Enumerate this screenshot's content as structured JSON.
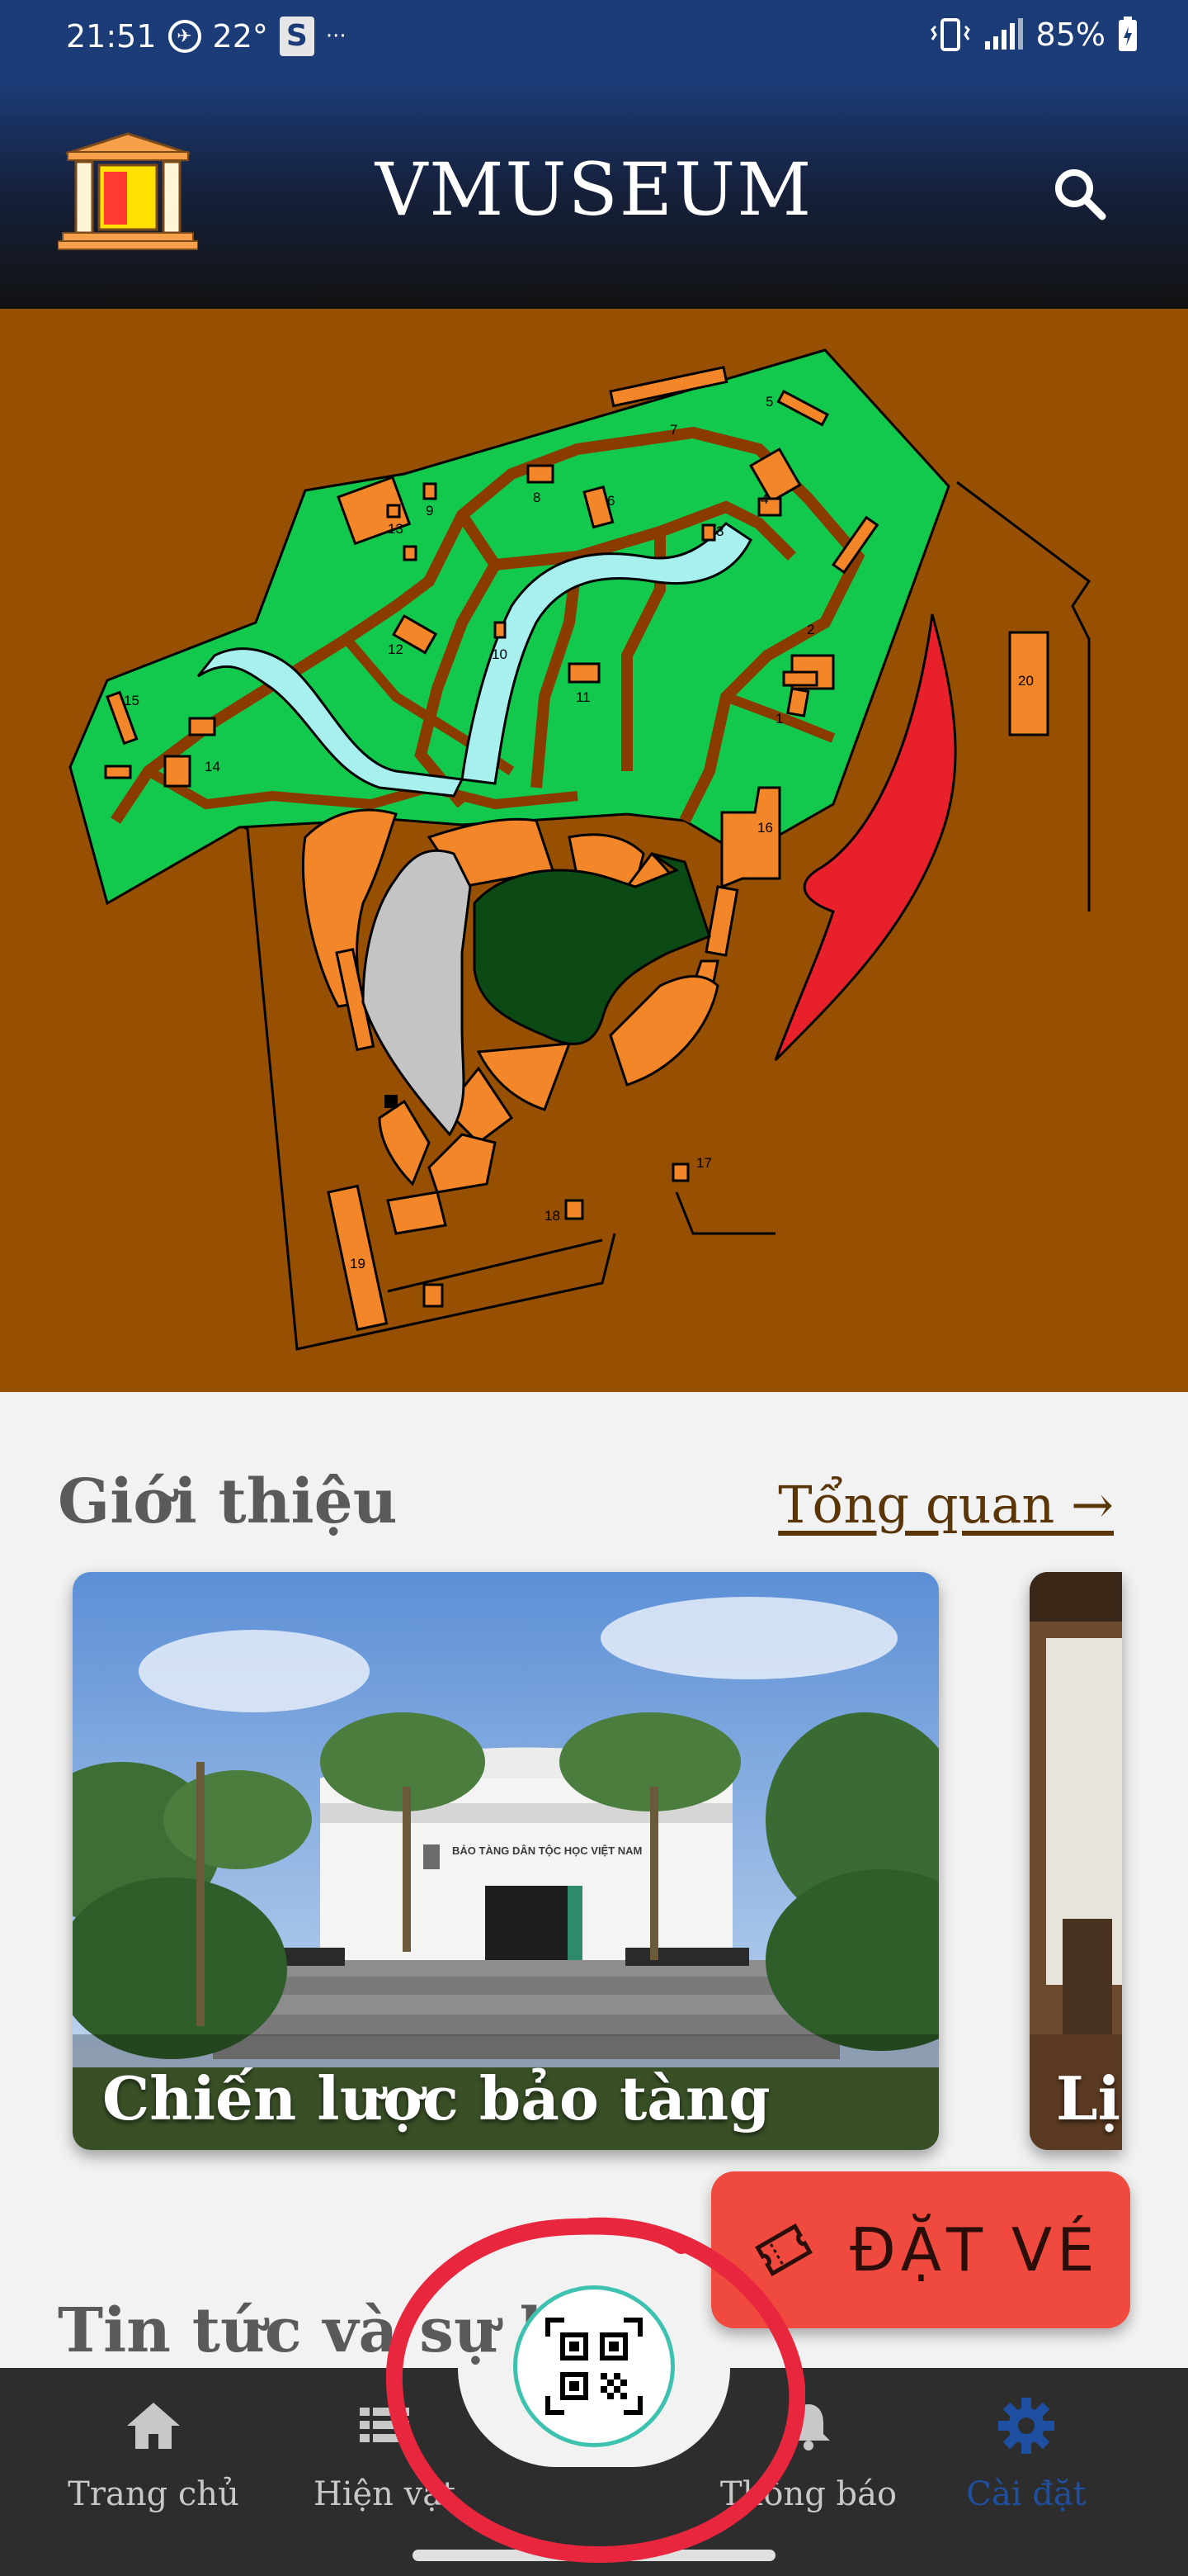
{
  "status_bar": {
    "time": "21:51",
    "temperature": "22°",
    "s_badge": "S",
    "more": "···",
    "battery": "85%"
  },
  "header": {
    "title": "VMUSEUM",
    "logo_icon": "museum-building-icon",
    "search_icon": "search-icon"
  },
  "map": {
    "labels": [
      "1",
      "2",
      "3",
      "4",
      "5",
      "6",
      "7",
      "8",
      "9",
      "10",
      "11",
      "12",
      "13",
      "14",
      "15",
      "16",
      "17",
      "18",
      "19",
      "20"
    ],
    "colors": {
      "ground": "#974f01",
      "garden": "#12c94e",
      "building": "#f38629",
      "pond": "#a8f0ee",
      "red_area": "#e8202a",
      "dark_area": "#0b4915",
      "grey_area": "#c4c4c4"
    }
  },
  "intro": {
    "title": "Giới thiệu",
    "overview_link": "Tổng quan →",
    "cards": [
      {
        "label": "Chiến lược bảo tàng",
        "sign_text": "BẢO TÀNG DÂN TỘC HỌC VIỆT NAM"
      },
      {
        "label": "Lị"
      }
    ]
  },
  "news": {
    "title": "Tin tức và sự kiện"
  },
  "book_button": {
    "label": "ĐẶT VÉ",
    "icon": "ticket-icon"
  },
  "bottom_nav": {
    "items": [
      {
        "label": "Trang chủ",
        "icon": "home-icon"
      },
      {
        "label": "Hiện vật",
        "icon": "list-icon"
      },
      {
        "label": "Thông báo",
        "icon": "bell-icon"
      },
      {
        "label": "Cài đặt",
        "icon": "gear-icon"
      }
    ],
    "qr_icon": "qr-code-icon",
    "active_color": "#1f4fa0"
  }
}
